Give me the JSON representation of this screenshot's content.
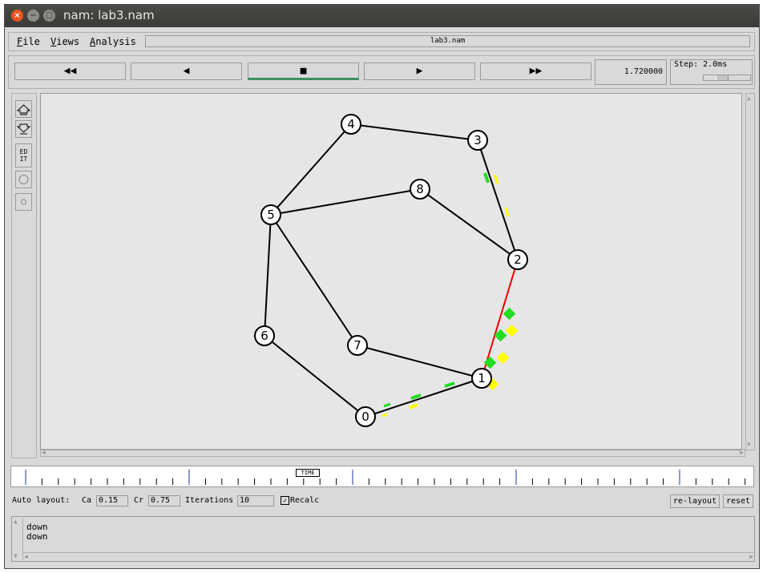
{
  "window": {
    "title": "nam: lab3.nam",
    "controls": {
      "close": "×",
      "minimize": "−",
      "maximize": "□"
    }
  },
  "menubar": {
    "file": {
      "accel": "F",
      "rest": "ile"
    },
    "views": {
      "accel": "V",
      "rest": "iews"
    },
    "analysis": {
      "accel": "A",
      "rest": "nalysis"
    },
    "filename": "lab3.nam"
  },
  "playback": {
    "rewind": "◀◀",
    "back": "◀",
    "stop": "■",
    "play": "▶",
    "fast_forward": "▶▶",
    "current_time": "1.720000",
    "step_label": "Step: 2.0ms"
  },
  "tools": {
    "zoom_in": "zoom-in-icon",
    "zoom_out": "zoom-out-icon",
    "edit": "ED\nIT",
    "node_large": "circle-icon",
    "node_small": "small-circle-icon"
  },
  "network": {
    "nodes": [
      {
        "id": "0"
      },
      {
        "id": "1"
      },
      {
        "id": "2"
      },
      {
        "id": "3"
      },
      {
        "id": "4"
      },
      {
        "id": "5"
      },
      {
        "id": "6"
      },
      {
        "id": "7"
      },
      {
        "id": "8"
      }
    ],
    "links": [
      [
        "4",
        "3"
      ],
      [
        "4",
        "5"
      ],
      [
        "5",
        "8"
      ],
      [
        "8",
        "2"
      ],
      [
        "3",
        "2"
      ],
      [
        "2",
        "1"
      ],
      [
        "5",
        "6"
      ],
      [
        "5",
        "7"
      ],
      [
        "7",
        "1"
      ],
      [
        "6",
        "0"
      ],
      [
        "0",
        "1"
      ]
    ],
    "link_states": {
      "2-1": "down"
    },
    "colors": {
      "link": "#000000",
      "link_down": "#ee0000",
      "packet_green": "#22dd22",
      "packet_yellow": "#ffff00"
    }
  },
  "timeline": {
    "marker_label": "TIME"
  },
  "auto_layout": {
    "label": "Auto layout:",
    "ca_label": "Ca",
    "ca_value": "0.15",
    "cr_label": "Cr",
    "cr_value": "0.75",
    "iterations_label": "Iterations",
    "iterations_value": "10",
    "recalc_label": "Recalc",
    "recalc_checked": "✓",
    "relayout_button": "re-layout",
    "reset_button": "reset"
  },
  "log": {
    "lines": [
      "down",
      "down"
    ]
  }
}
